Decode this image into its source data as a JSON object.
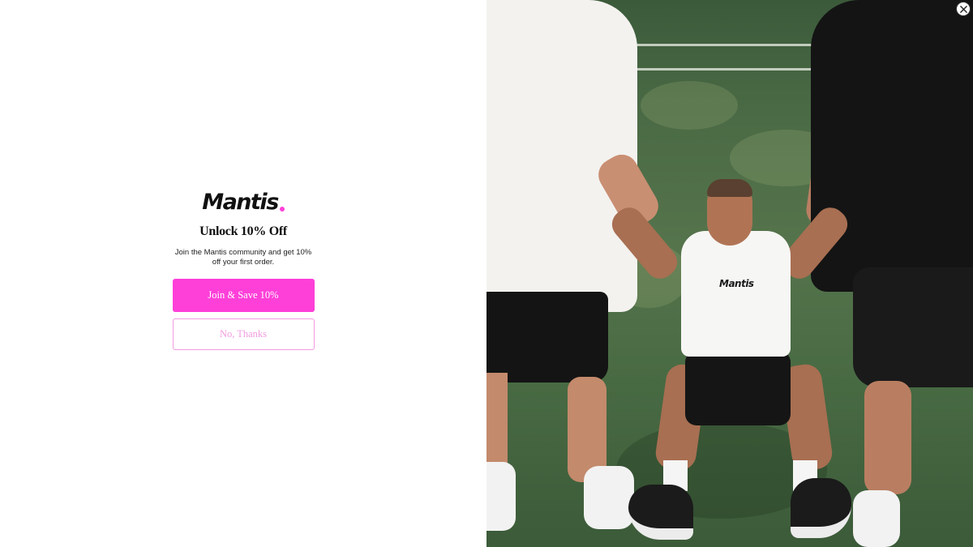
{
  "popup": {
    "logo_text": "Mantis",
    "headline": "Unlock 10% Off",
    "subtext": "Join the Mantis community and get 10% off your first order.",
    "primary_button": "Join & Save 10%",
    "secondary_button": "No, Thanks",
    "close_icon": "close-icon"
  },
  "photo": {
    "shirt_logo": "Mantis"
  },
  "colors": {
    "brand_pink": "#fe3fd8",
    "secondary_border": "#f29be0",
    "secondary_text": "#f29be0",
    "text_dark": "#111111"
  }
}
